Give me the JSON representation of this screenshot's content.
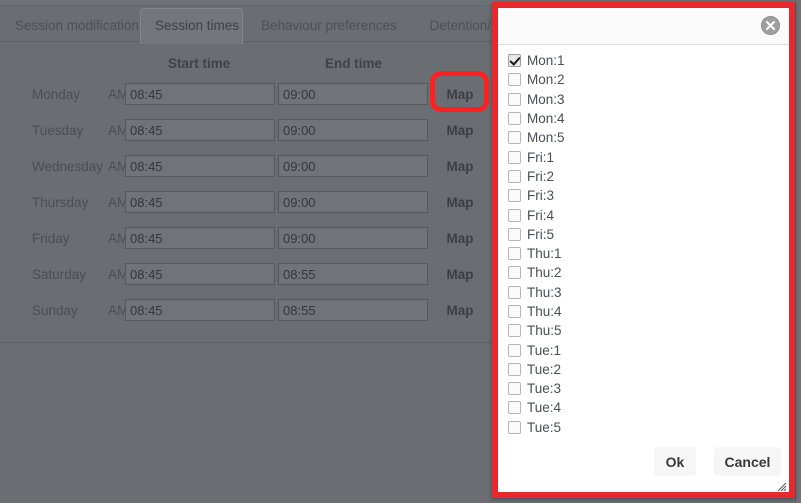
{
  "tabs": [
    {
      "label": "Session modification",
      "active": false
    },
    {
      "label": "Session times",
      "active": true
    },
    {
      "label": "Behaviour preferences",
      "active": false
    },
    {
      "label": "Detention/remov",
      "active": false
    }
  ],
  "times_table": {
    "headers": {
      "start": "Start time",
      "end": "End time"
    },
    "map_label": "Map",
    "rows": [
      {
        "day": "Monday",
        "ampm": "AM",
        "start": "08:45",
        "end": "09:00",
        "map": "Map"
      },
      {
        "day": "Tuesday",
        "ampm": "AM",
        "start": "08:45",
        "end": "09:00",
        "map": "Map"
      },
      {
        "day": "Wednesday",
        "ampm": "AM",
        "start": "08:45",
        "end": "09:00",
        "map": "Map"
      },
      {
        "day": "Thursday",
        "ampm": "AM",
        "start": "08:45",
        "end": "09:00",
        "map": "Map"
      },
      {
        "day": "Friday",
        "ampm": "AM",
        "start": "08:45",
        "end": "09:00",
        "map": "Map"
      },
      {
        "day": "Saturday",
        "ampm": "AM",
        "start": "08:45",
        "end": "08:55",
        "map": "Map"
      },
      {
        "day": "Sunday",
        "ampm": "AM",
        "start": "08:45",
        "end": "08:55",
        "map": "Map"
      }
    ]
  },
  "dialog": {
    "title": "",
    "close_icon": "close-circle-icon",
    "items": [
      {
        "label": "Mon:1",
        "checked": true
      },
      {
        "label": "Mon:2",
        "checked": false
      },
      {
        "label": "Mon:3",
        "checked": false
      },
      {
        "label": "Mon:4",
        "checked": false
      },
      {
        "label": "Mon:5",
        "checked": false
      },
      {
        "label": "Fri:1",
        "checked": false
      },
      {
        "label": "Fri:2",
        "checked": false
      },
      {
        "label": "Fri:3",
        "checked": false
      },
      {
        "label": "Fri:4",
        "checked": false
      },
      {
        "label": "Fri:5",
        "checked": false
      },
      {
        "label": "Thu:1",
        "checked": false
      },
      {
        "label": "Thu:2",
        "checked": false
      },
      {
        "label": "Thu:3",
        "checked": false
      },
      {
        "label": "Thu:4",
        "checked": false
      },
      {
        "label": "Thu:5",
        "checked": false
      },
      {
        "label": "Tue:1",
        "checked": false
      },
      {
        "label": "Tue:2",
        "checked": false
      },
      {
        "label": "Tue:3",
        "checked": false
      },
      {
        "label": "Tue:4",
        "checked": false
      },
      {
        "label": "Tue:5",
        "checked": false
      }
    ],
    "ok_label": "Ok",
    "cancel_label": "Cancel",
    "resize_grip": "resize-grip-icon"
  },
  "annotation": {
    "target": "Map",
    "color": "#fe2020"
  },
  "colors": {
    "backdrop": "#6a6d72",
    "dialog_border": "#e8282d",
    "dialog_bg": "#ffffff",
    "highlight": "#fe2020"
  }
}
